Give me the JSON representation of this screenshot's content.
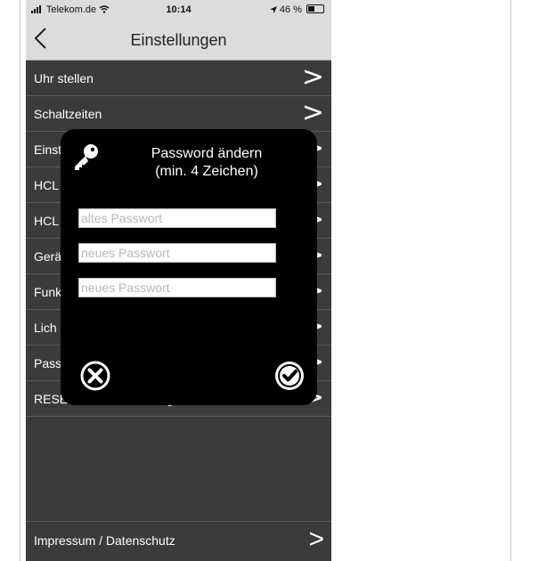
{
  "status_bar": {
    "carrier": "Telekom.de",
    "time": "10:14",
    "battery": "46 %",
    "icons": [
      "signal-icon",
      "wifi-icon",
      "location-icon",
      "battery-icon"
    ]
  },
  "nav": {
    "title": "Einstellungen",
    "back_icon": "chevron-left-icon"
  },
  "menu": {
    "items": [
      {
        "label": "Uhr stellen"
      },
      {
        "label": "Schaltzeiten"
      },
      {
        "label": "Einst"
      },
      {
        "label": "HCL"
      },
      {
        "label": "HCL"
      },
      {
        "label": "Gerä"
      },
      {
        "label": "Funk"
      },
      {
        "label": "Lich"
      },
      {
        "label": "Pass"
      },
      {
        "label": "RESET Werkseinstellungen"
      }
    ],
    "chevron": ">",
    "bottom_item": "Impressum / Datenschutz"
  },
  "dialog": {
    "title_line1": "Password ändern",
    "title_line2": "(min. 4 Zeichen)",
    "old_placeholder": "altes Passwort",
    "new_placeholder": "neues Passwort",
    "confirm_placeholder": "neues Passwort",
    "icons": [
      "key-icon",
      "close-circle-icon",
      "check-circle-icon"
    ]
  },
  "colors": {
    "list_bg": "#3b3b3b",
    "nav_bg": "#dcdcdc",
    "dialog_bg": "#000000",
    "text": "#ffffff"
  }
}
